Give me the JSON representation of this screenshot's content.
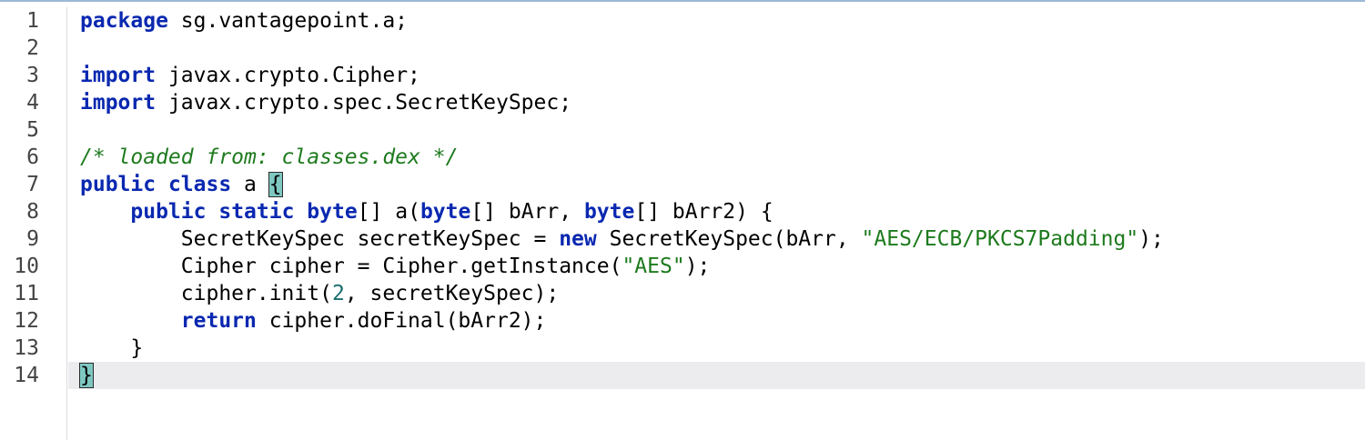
{
  "editor": {
    "line_numbers": [
      "1",
      "2",
      "3",
      "4",
      "5",
      "6",
      "7",
      "8",
      "9",
      "10",
      "11",
      "12",
      "13",
      "14"
    ],
    "lines": [
      [
        {
          "t": "kw",
          "v": "package"
        },
        {
          "t": "p",
          "v": " sg.vantagepoint.a;"
        }
      ],
      [],
      [
        {
          "t": "kw",
          "v": "import"
        },
        {
          "t": "p",
          "v": " javax.crypto.Cipher;"
        }
      ],
      [
        {
          "t": "kw",
          "v": "import"
        },
        {
          "t": "p",
          "v": " javax.crypto.spec.SecretKeySpec;"
        }
      ],
      [],
      [
        {
          "t": "comment",
          "v": "/* loaded from: classes.dex */"
        }
      ],
      [
        {
          "t": "kw",
          "v": "public"
        },
        {
          "t": "p",
          "v": " "
        },
        {
          "t": "kw",
          "v": "class"
        },
        {
          "t": "p",
          "v": " a "
        },
        {
          "t": "brace",
          "v": "{"
        }
      ],
      [
        {
          "t": "p",
          "v": "    "
        },
        {
          "t": "kw",
          "v": "public"
        },
        {
          "t": "p",
          "v": " "
        },
        {
          "t": "kw",
          "v": "static"
        },
        {
          "t": "p",
          "v": " "
        },
        {
          "t": "kw",
          "v": "byte"
        },
        {
          "t": "p",
          "v": "[] a("
        },
        {
          "t": "kw",
          "v": "byte"
        },
        {
          "t": "p",
          "v": "[] bArr, "
        },
        {
          "t": "kw",
          "v": "byte"
        },
        {
          "t": "p",
          "v": "[] bArr2) {"
        }
      ],
      [
        {
          "t": "p",
          "v": "        SecretKeySpec secretKeySpec = "
        },
        {
          "t": "kw",
          "v": "new"
        },
        {
          "t": "p",
          "v": " SecretKeySpec(bArr, "
        },
        {
          "t": "str",
          "v": "\"AES/ECB/PKCS7Padding\""
        },
        {
          "t": "p",
          "v": ");"
        }
      ],
      [
        {
          "t": "p",
          "v": "        Cipher cipher = Cipher.getInstance("
        },
        {
          "t": "str",
          "v": "\"AES\""
        },
        {
          "t": "p",
          "v": ");"
        }
      ],
      [
        {
          "t": "p",
          "v": "        cipher.init("
        },
        {
          "t": "num",
          "v": "2"
        },
        {
          "t": "p",
          "v": ", secretKeySpec);"
        }
      ],
      [
        {
          "t": "p",
          "v": "        "
        },
        {
          "t": "kw",
          "v": "return"
        },
        {
          "t": "p",
          "v": " cipher.doFinal(bArr2);"
        }
      ],
      [
        {
          "t": "p",
          "v": "    }"
        }
      ],
      [
        {
          "t": "brace",
          "v": "}"
        }
      ]
    ],
    "current_line_index": 13
  }
}
